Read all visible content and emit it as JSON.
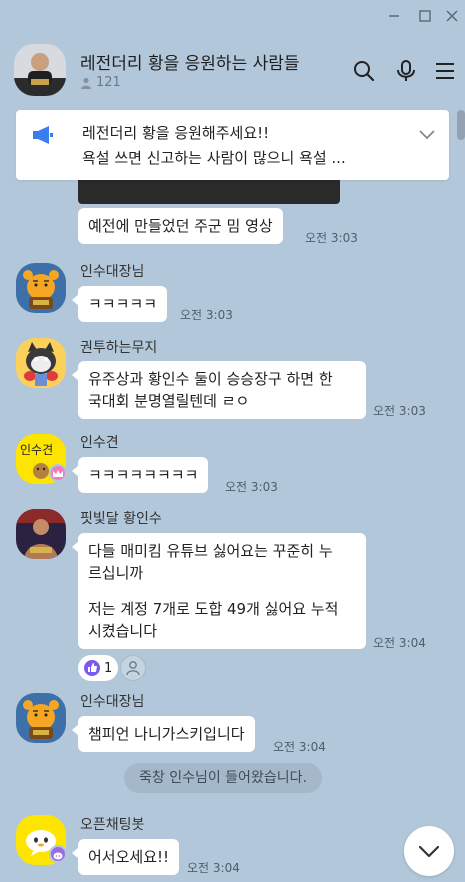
{
  "room": {
    "title": "레전더리 황을 응원하는 사람들",
    "member_count": "121"
  },
  "notice": {
    "line1": "레전더리 황을 응원해주세요!!",
    "line2": "욕설 쓰면 신고하는 사람이 많으니 욕설 ..."
  },
  "messages": [
    {
      "sender": "",
      "text": "예전에 만들었던 주군 밈 영상",
      "time": "오전 3:03"
    },
    {
      "sender": "인수대장님",
      "text": "ㅋㅋㅋㅋㅋ",
      "time": "오전 3:03"
    },
    {
      "sender": "권투하는무지",
      "line1": "유주상과 황인수 둘이 승승장구 하면 한",
      "line2": "국대회 분명열릴텐데 ㄹㅇ",
      "time": "오전 3:03"
    },
    {
      "sender": "인수견",
      "avatar_text": "인수견",
      "text": "ㅋㅋㅋㅋㅋㅋㅋㅋ",
      "time": "오전 3:03"
    },
    {
      "sender": "핏빛달 황인수",
      "line1": "다들 매미킴 유튜브 싫어요는 꾸준히 누",
      "line2": "르십니까",
      "line3": "저는 계정 7개로 도합 49개 싫어요 누적",
      "line4": "시켰습니다",
      "time": "오전 3:04",
      "reaction_count": "1"
    },
    {
      "sender": "인수대장님",
      "text": "챔피언 나니가스키입니다",
      "time": "오전 3:04"
    },
    {
      "sender": "오픈채팅봇",
      "text": "어서오세요!!",
      "time": "오전 3:04"
    }
  ],
  "system_message": "죽창 인수님이 들어왔습니다.",
  "colors": {
    "background": "#b2c7da",
    "bubble": "#ffffff",
    "notice_icon": "#3b7cf0",
    "ryan": "#f5a623",
    "kakao_yellow": "#fee500"
  },
  "icons": {
    "header": [
      "search-icon",
      "mic-icon",
      "menu-icon"
    ],
    "window": [
      "minimize-icon",
      "maximize-icon",
      "close-icon"
    ]
  }
}
